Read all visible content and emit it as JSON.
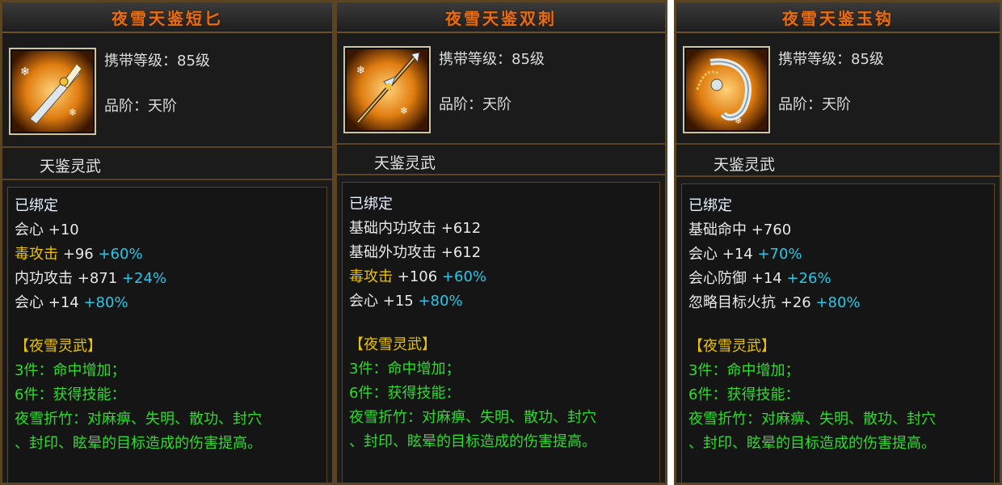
{
  "items": [
    {
      "title": "夜雪天鉴短匕",
      "icon": "dagger-icon",
      "level_label": "携带等级：85级",
      "grade_label": "品阶：天阶",
      "type": "天鉴灵武",
      "bound": "已绑定",
      "stats": [
        {
          "name": "会心",
          "value": "+10",
          "bonus": ""
        },
        {
          "name": "毒攻击",
          "value": "+96",
          "bonus": "+60%"
        },
        {
          "name": "内功攻击",
          "value": "+871",
          "bonus": "+24%"
        },
        {
          "name": "会心",
          "value": "+14",
          "bonus": "+80%"
        }
      ],
      "set_title": "【夜雪灵武】",
      "set_lines": [
        "3件：命中增加；",
        "6件：获得技能：",
        "夜雪折竹：对麻痹、失明、散功、封穴",
        "、封印、眩晕的目标造成的伤害提高。"
      ]
    },
    {
      "title": "夜雪天鉴双刺",
      "icon": "double-spike-icon",
      "level_label": "携带等级：85级",
      "grade_label": "品阶：天阶",
      "type": "天鉴灵武",
      "bound": "已绑定",
      "stats": [
        {
          "name": "基础内功攻击",
          "value": "+612",
          "bonus": ""
        },
        {
          "name": "基础外功攻击",
          "value": "+612",
          "bonus": ""
        },
        {
          "name": "毒攻击",
          "value": "+106",
          "bonus": "+60%"
        },
        {
          "name": "会心",
          "value": "+15",
          "bonus": "+80%"
        }
      ],
      "set_title": "【夜雪灵武】",
      "set_lines": [
        "3件：命中增加；",
        "6件：获得技能：",
        "夜雪折竹：对麻痹、失明、散功、封穴",
        "、封印、眩晕的目标造成的伤害提高。"
      ]
    },
    {
      "title": "夜雪天鉴玉钩",
      "icon": "jade-hook-icon",
      "level_label": "携带等级：85级",
      "grade_label": "品阶：天阶",
      "type": "天鉴灵武",
      "bound": "已绑定",
      "stats": [
        {
          "name": "基础命中",
          "value": "+760",
          "bonus": ""
        },
        {
          "name": "会心",
          "value": "+14",
          "bonus": "+70%"
        },
        {
          "name": "会心防御",
          "value": "+14",
          "bonus": "+26%"
        },
        {
          "name": "忽略目标火抗",
          "value": "+26",
          "bonus": "+80%"
        }
      ],
      "set_title": "【夜雪灵武】",
      "set_lines": [
        "3件：命中增加；",
        "6件：获得技能：",
        "夜雪折竹：对麻痹、失明、散功、封穴",
        "、封印、眩晕的目标造成的伤害提高。"
      ]
    }
  ]
}
